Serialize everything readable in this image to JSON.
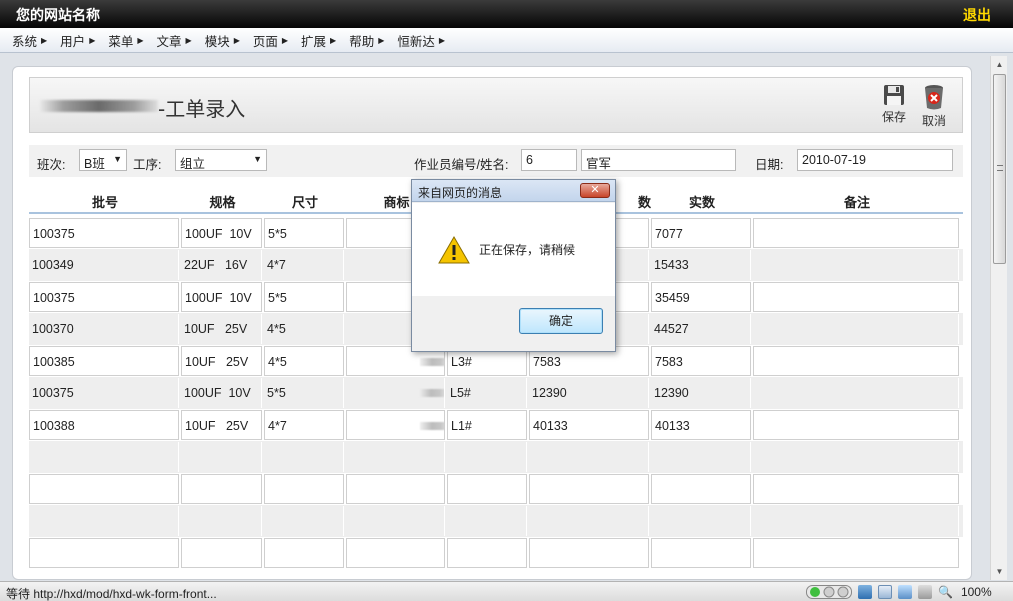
{
  "header": {
    "site_name": "您的网站名称",
    "logout": "退出"
  },
  "menu": [
    "系统",
    "用户",
    "菜单",
    "文章",
    "模块",
    "页面",
    "扩展",
    "帮助",
    "恒新达"
  ],
  "page": {
    "title": "-工单录入",
    "save": "保存",
    "cancel": "取消"
  },
  "filters": {
    "shift_label": "班次:",
    "shift_value": "B班",
    "process_label": "工序:",
    "process_value": "组立",
    "operator_label": "作业员编号/姓名:",
    "operator_id": "6",
    "operator_name": "官军",
    "date_label": "日期:",
    "date_value": "2010-07-19"
  },
  "table": {
    "headers": [
      "批号",
      "规格",
      "尺寸",
      "商标",
      "",
      "数",
      "实数",
      "备注"
    ],
    "rows": [
      [
        "100375",
        "100UF  10V",
        "5*5",
        "",
        "",
        "",
        "7077",
        ""
      ],
      [
        "100349",
        "22UF   16V",
        "4*7",
        "",
        "",
        "",
        "15433",
        ""
      ],
      [
        "100375",
        "100UF  10V",
        "5*5",
        "",
        "",
        "",
        "35459",
        ""
      ],
      [
        "100370",
        "10UF   25V",
        "4*5",
        "",
        "",
        "",
        "44527",
        ""
      ],
      [
        "100385",
        "10UF   25V",
        "4*5",
        "",
        "L3#",
        "7583",
        "7583",
        ""
      ],
      [
        "100375",
        "100UF  10V",
        "5*5",
        "",
        "L5#",
        "12390",
        "12390",
        ""
      ],
      [
        "100388",
        "10UF   25V",
        "4*7",
        "",
        "L1#",
        "40133",
        "40133",
        ""
      ],
      [
        "",
        "",
        "",
        "",
        "",
        "",
        "",
        ""
      ],
      [
        "",
        "",
        "",
        "",
        "",
        "",
        "",
        ""
      ],
      [
        "",
        "",
        "",
        "",
        "",
        "",
        "",
        ""
      ],
      [
        "",
        "",
        "",
        "",
        "",
        "",
        "",
        ""
      ]
    ]
  },
  "dialog": {
    "title": "来自网页的消息",
    "close": "✕",
    "message": "正在保存，请稍候",
    "ok": "确定"
  },
  "status": {
    "text": "等待 http://hxd/mod/hxd-wk-form-front...",
    "zoom": "100%"
  }
}
